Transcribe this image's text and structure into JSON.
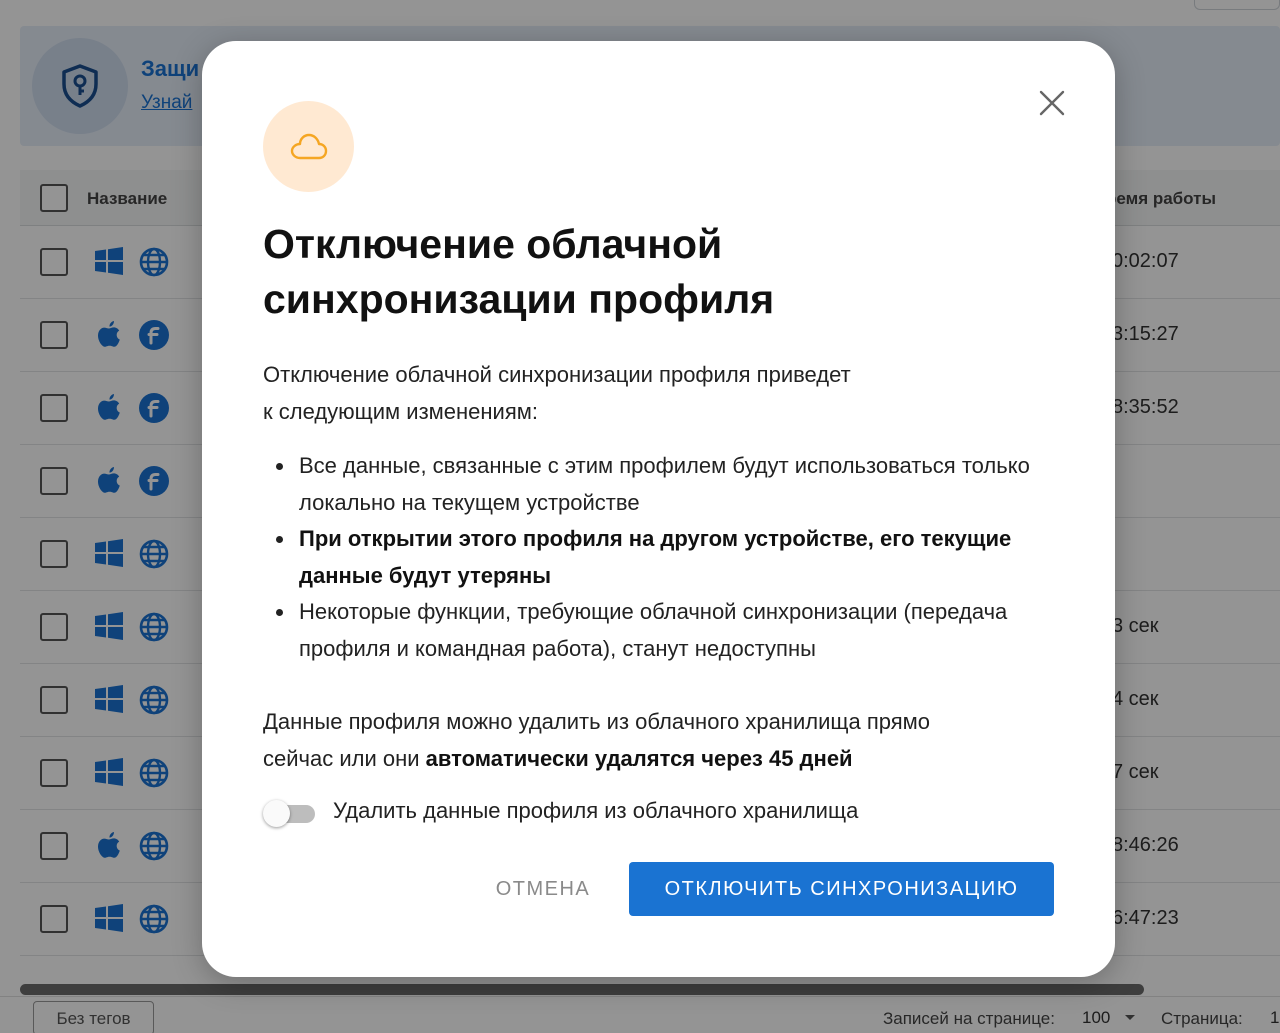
{
  "background": {
    "banner": {
      "title": "Защи",
      "link": "Узнай",
      "icon": "shield-key-icon"
    },
    "table": {
      "headers": {
        "name": "Название",
        "uptime": "ремя работы"
      },
      "rows": [
        {
          "os": "windows-icon",
          "browser": "globe-icon",
          "uptime": "0:02:07"
        },
        {
          "os": "apple-icon",
          "browser": "firefox-f-icon",
          "uptime": "3:15:27"
        },
        {
          "os": "apple-icon",
          "browser": "firefox-f-icon",
          "uptime": "8:35:52"
        },
        {
          "os": "apple-icon",
          "browser": "firefox-f-icon",
          "uptime": ""
        },
        {
          "os": "windows-icon",
          "browser": "globe-icon",
          "uptime": ""
        },
        {
          "os": "windows-icon",
          "browser": "globe-icon",
          "uptime": "3 сек"
        },
        {
          "os": "windows-icon",
          "browser": "globe-icon",
          "uptime": "4 сек"
        },
        {
          "os": "windows-icon",
          "browser": "globe-icon",
          "uptime": "7 сек"
        },
        {
          "os": "apple-icon",
          "browser": "globe-icon",
          "uptime": "8:46:26"
        },
        {
          "os": "windows-icon",
          "browser": "globe-icon",
          "uptime": "6:47:23"
        }
      ]
    },
    "footer": {
      "tag_button": "Без тегов",
      "per_page_label": "Записей на странице:",
      "per_page_value": "100",
      "page_label": "Страница:",
      "page_value": "1"
    }
  },
  "modal": {
    "icon": "cloud-icon",
    "close_icon": "close-icon",
    "title_line1": "Отключение облачной",
    "title_line2": "синхронизации профиля",
    "intro_line1": "Отключение облачной синхронизации профиля приведет",
    "intro_line2": "к следующим изменениям:",
    "bullets": [
      "Все данные, связанные с этим профилем будут использоваться только локально на текущем устройстве",
      "При открытии этого профиля на другом устройстве, его текущие данные будут утеряны",
      "Некоторые функции, требующие облачной синхронизации (передача профиля и командная работа), станут недоступны"
    ],
    "note_line1": "Данные профиля можно удалить из облачного хранилища прямо",
    "note_line2_prefix": "сейчас или они ",
    "note_line2_bold": "автоматически удалятся через 45 дней",
    "toggle_label": "Удалить данные профиля из облачного хранилища",
    "toggle_on": false,
    "cancel_label": "ОТМЕНА",
    "confirm_label": "ОТКЛЮЧИТЬ СИНХРОНИЗАЦИЮ"
  },
  "colors": {
    "accent": "#1a73d2",
    "cloud_circle_bg": "#ffe9d2",
    "cloud_stroke": "#f5a623",
    "overlay": "rgba(0,0,0,0.42)"
  }
}
